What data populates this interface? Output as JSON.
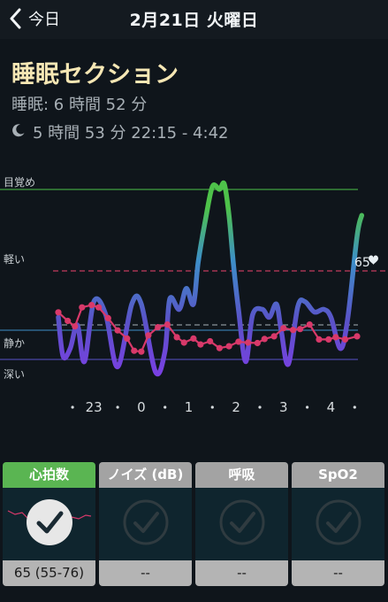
{
  "nav": {
    "back_label": "今日",
    "title": "2月21日 火曜日"
  },
  "header": {
    "title": "睡眠セクション",
    "sleep_total": "睡眠: 6 時間 52 分",
    "sleep_detail": "5 時間 53 分 22:15 - 4:42"
  },
  "chart_data": {
    "type": "line",
    "y_stage_labels": [
      "目覚め",
      "軽い",
      "静か",
      "深い"
    ],
    "x_ticks": [
      "23",
      "0",
      "1",
      "2",
      "3",
      "4"
    ],
    "x_tick_hours": [
      23,
      24,
      25,
      26,
      27,
      28
    ],
    "x_range": [
      22.25,
      28.7
    ],
    "heart_rate_label": "65",
    "heart_rate_avg": 65,
    "heart_rate_range": [
      55,
      76
    ],
    "heart_rate": [
      {
        "x": 22.25,
        "y": 70.5
      },
      {
        "x": 22.45,
        "y": 68.6
      },
      {
        "x": 22.6,
        "y": 67.4
      },
      {
        "x": 22.75,
        "y": 71.6
      },
      {
        "x": 22.95,
        "y": 72.1
      },
      {
        "x": 23.1,
        "y": 71.6
      },
      {
        "x": 23.3,
        "y": 69.2
      },
      {
        "x": 23.5,
        "y": 66.5
      },
      {
        "x": 23.7,
        "y": 64.7
      },
      {
        "x": 23.85,
        "y": 62.0
      },
      {
        "x": 24.0,
        "y": 61.8
      },
      {
        "x": 24.15,
        "y": 65.4
      },
      {
        "x": 24.35,
        "y": 67.2
      },
      {
        "x": 24.55,
        "y": 67.8
      },
      {
        "x": 24.75,
        "y": 65.0
      },
      {
        "x": 24.9,
        "y": 63.8
      },
      {
        "x": 25.1,
        "y": 64.7
      },
      {
        "x": 25.25,
        "y": 63.4
      },
      {
        "x": 25.45,
        "y": 64.1
      },
      {
        "x": 25.65,
        "y": 62.6
      },
      {
        "x": 25.85,
        "y": 63.0
      },
      {
        "x": 26.05,
        "y": 64.0
      },
      {
        "x": 26.25,
        "y": 63.8
      },
      {
        "x": 26.45,
        "y": 63.7
      },
      {
        "x": 26.6,
        "y": 64.6
      },
      {
        "x": 26.8,
        "y": 65.2
      },
      {
        "x": 27.0,
        "y": 67.0
      },
      {
        "x": 27.2,
        "y": 66.6
      },
      {
        "x": 27.35,
        "y": 66.8
      },
      {
        "x": 27.55,
        "y": 67.8
      },
      {
        "x": 27.75,
        "y": 64.5
      },
      {
        "x": 27.95,
        "y": 64.5
      },
      {
        "x": 28.1,
        "y": 65.0
      },
      {
        "x": 28.3,
        "y": 64.5
      },
      {
        "x": 28.55,
        "y": 65.2
      }
    ],
    "hr_ylim": [
      55,
      100
    ],
    "hr_avg_line": 65.5,
    "sleep_stage": [
      {
        "x": 22.25,
        "y": 1.05
      },
      {
        "x": 22.35,
        "y": 0.3
      },
      {
        "x": 22.5,
        "y": 0.45
      },
      {
        "x": 22.65,
        "y": 0.9
      },
      {
        "x": 22.8,
        "y": 0.2
      },
      {
        "x": 23.0,
        "y": 1.35
      },
      {
        "x": 23.25,
        "y": 1.1
      },
      {
        "x": 23.5,
        "y": 0.1
      },
      {
        "x": 23.8,
        "y": 1.3
      },
      {
        "x": 24.0,
        "y": 1.3
      },
      {
        "x": 24.3,
        "y": 0.0
      },
      {
        "x": 24.5,
        "y": 0.4
      },
      {
        "x": 24.6,
        "y": 1.4
      },
      {
        "x": 24.8,
        "y": 1.2
      },
      {
        "x": 24.95,
        "y": 1.6
      },
      {
        "x": 25.1,
        "y": 1.3
      },
      {
        "x": 25.2,
        "y": 2.1
      },
      {
        "x": 25.35,
        "y": 2.9
      },
      {
        "x": 25.5,
        "y": 3.55
      },
      {
        "x": 25.65,
        "y": 3.5
      },
      {
        "x": 25.75,
        "y": 3.6
      },
      {
        "x": 25.85,
        "y": 3.0
      },
      {
        "x": 25.95,
        "y": 2.0
      },
      {
        "x": 26.05,
        "y": 1.2
      },
      {
        "x": 26.2,
        "y": 0.2
      },
      {
        "x": 26.35,
        "y": 1.1
      },
      {
        "x": 26.55,
        "y": 1.2
      },
      {
        "x": 26.7,
        "y": 1.05
      },
      {
        "x": 26.85,
        "y": 1.3
      },
      {
        "x": 26.95,
        "y": 0.8
      },
      {
        "x": 27.1,
        "y": 0.15
      },
      {
        "x": 27.3,
        "y": 1.25
      },
      {
        "x": 27.45,
        "y": 1.35
      },
      {
        "x": 27.65,
        "y": 1.15
      },
      {
        "x": 27.85,
        "y": 1.2
      },
      {
        "x": 28.0,
        "y": 1.05
      },
      {
        "x": 28.2,
        "y": 0.45
      },
      {
        "x": 28.35,
        "y": 1.0
      },
      {
        "x": 28.55,
        "y": 2.6
      },
      {
        "x": 28.65,
        "y": 3.0
      }
    ],
    "stage_ylim": [
      -0.2,
      3.7
    ]
  },
  "colors": {
    "hr_line": "#d8396a",
    "wake": "#4ec24a",
    "light": "#3d8fc8",
    "quiet": "#5a52c8",
    "deep": "#7e3de6",
    "accent_green": "#5ab552"
  },
  "tabs": [
    {
      "label": "心拍数",
      "value": "65 (55-76)",
      "icon": "check-icon"
    },
    {
      "label": "ノイズ (dB)",
      "value": "--",
      "icon": "check-icon"
    },
    {
      "label": "呼吸",
      "value": "--",
      "icon": "check-icon"
    },
    {
      "label": "SpO2",
      "value": "--",
      "icon": "check-icon"
    }
  ]
}
